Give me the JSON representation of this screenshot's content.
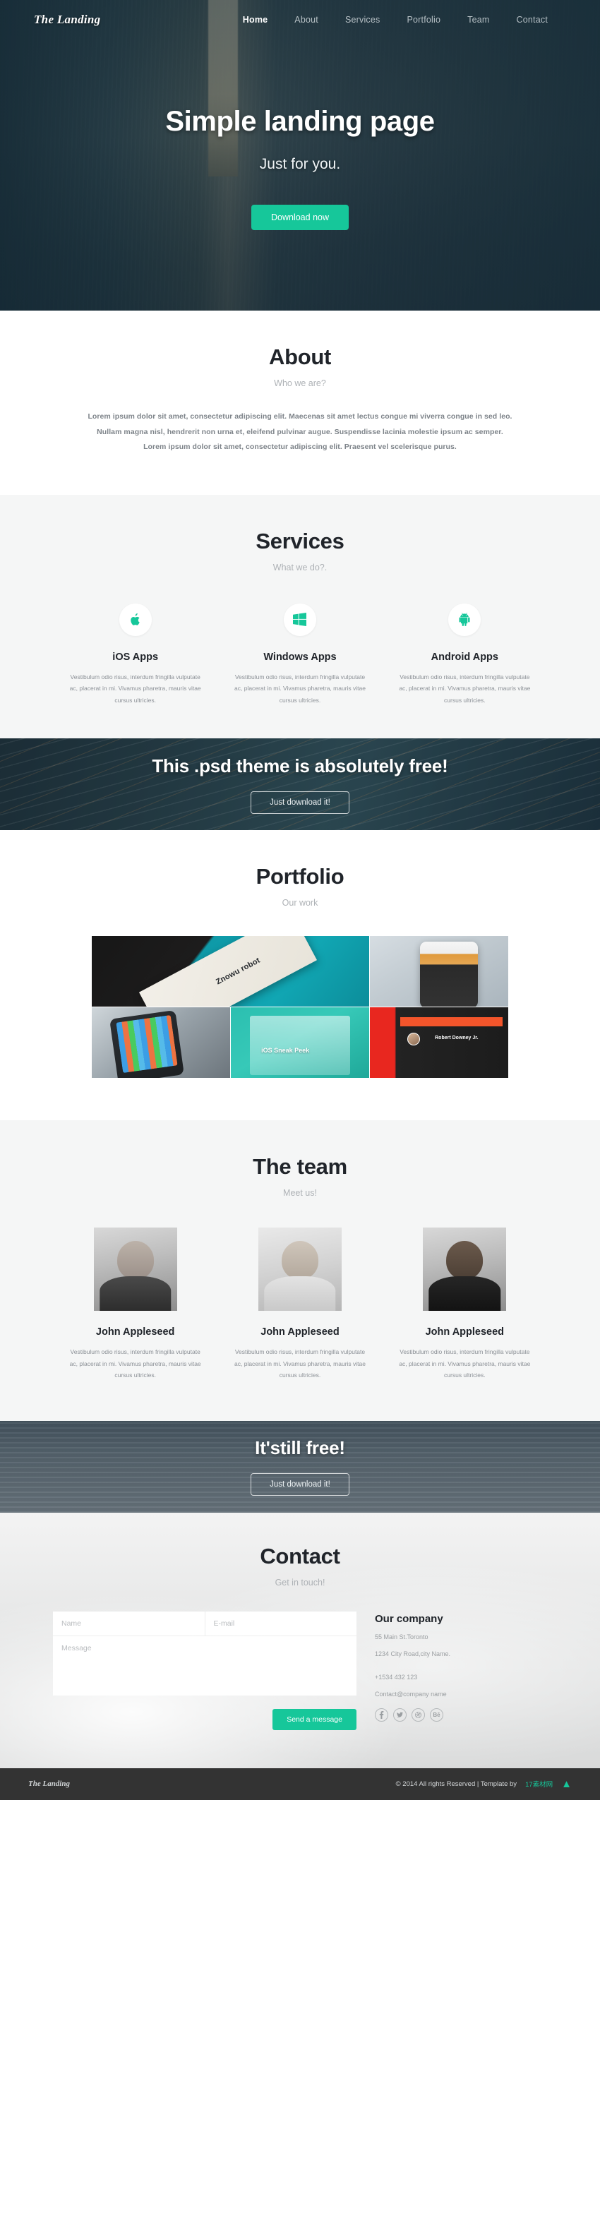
{
  "nav": {
    "brand": "The Landing",
    "items": [
      {
        "label": "Home",
        "active": true
      },
      {
        "label": "About",
        "active": false
      },
      {
        "label": "Services",
        "active": false
      },
      {
        "label": "Portfolio",
        "active": false
      },
      {
        "label": "Team",
        "active": false
      },
      {
        "label": "Contact",
        "active": false
      }
    ]
  },
  "hero": {
    "title": "Simple landing page",
    "subtitle": "Just for you.",
    "button": "Download now"
  },
  "about": {
    "title": "About",
    "subtitle": "Who we are?",
    "lines": [
      "Lorem ipsum dolor sit amet, consectetur adipiscing elit. Maecenas sit amet lectus congue mi viverra congue in sed leo.",
      "Nullam magna nisl, hendrerit non urna et, eleifend pulvinar augue. Suspendisse lacinia molestie ipsum ac semper.",
      "Lorem ipsum dolor sit amet, consectetur adipiscing elit. Praesent vel scelerisque purus."
    ]
  },
  "services": {
    "title": "Services",
    "subtitle": "What we do?.",
    "items": [
      {
        "icon": "apple-icon",
        "name": "iOS Apps",
        "text": "Vestibulum odio risus, interdum fringilla vulputate ac, placerat in mi. Vivamus pharetra, mauris vitae cursus ultricies."
      },
      {
        "icon": "windows-icon",
        "name": "Windows Apps",
        "text": "Vestibulum odio risus, interdum fringilla vulputate ac, placerat in mi. Vivamus pharetra, mauris vitae cursus ultricies."
      },
      {
        "icon": "android-icon",
        "name": "Android Apps",
        "text": "Vestibulum odio risus, interdum fringilla vulputate ac, placerat in mi. Vivamus pharetra, mauris vitae cursus ultricies."
      }
    ]
  },
  "cta1": {
    "title": "This .psd theme is absolutely free!",
    "button": "Just download it!"
  },
  "portfolio": {
    "title": "Portfolio",
    "subtitle": "Our work",
    "items": [
      {
        "caption": "Znowu robot"
      },
      {
        "caption": ""
      },
      {
        "caption": ""
      },
      {
        "caption": "iOS Sneak Peek"
      },
      {
        "caption": "Robert Downey Jr."
      }
    ]
  },
  "team": {
    "title": "The team",
    "subtitle": "Meet us!",
    "members": [
      {
        "name": "John Appleseed",
        "text": "Vestibulum odio risus, interdum fringilla vulputate ac, placerat in mi. Vivamus pharetra, mauris vitae cursus ultricies."
      },
      {
        "name": "John Appleseed",
        "text": "Vestibulum odio risus, interdum fringilla vulputate ac, placerat in mi. Vivamus pharetra, mauris vitae cursus ultricies."
      },
      {
        "name": "John Appleseed",
        "text": "Vestibulum odio risus, interdum fringilla vulputate ac, placerat in mi. Vivamus pharetra, mauris vitae cursus ultricies."
      }
    ]
  },
  "cta2": {
    "title": "It'still free!",
    "button": "Just download it!"
  },
  "contact": {
    "title": "Contact",
    "subtitle": "Get in touch!",
    "form": {
      "name_placeholder": "Name",
      "email_placeholder": "E-mail",
      "message_placeholder": "Message",
      "submit": "Send a message"
    },
    "company": {
      "title": "Our company",
      "address1": "55 Main St.Toronto",
      "address2": "1234 City Road,city Name.",
      "phone": "+1534 432 123",
      "email": "Contact@company name",
      "socials": [
        "facebook-icon",
        "twitter-icon",
        "dribbble-icon",
        "behance-icon"
      ]
    }
  },
  "footer": {
    "brand": "The Landing",
    "copyright": "© 2014 All rights Reserved | Template by",
    "credit": "17素材网",
    "top_arrow": "▲"
  },
  "colors": {
    "accent": "#16c79a",
    "dark": "#243c48",
    "footer": "#333333",
    "muted": "#8b9096"
  }
}
